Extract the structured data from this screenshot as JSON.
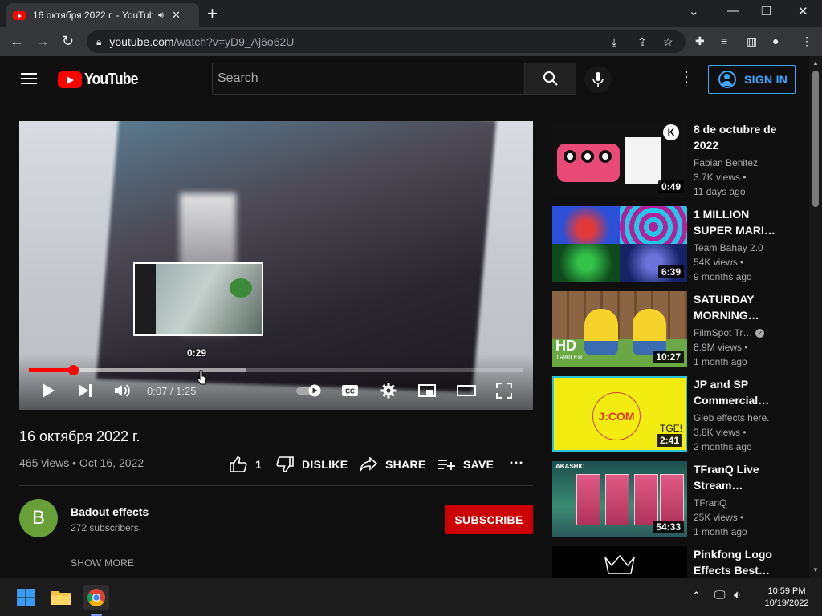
{
  "browser": {
    "tab_title": "16 октября 2022 г. - YouTube",
    "url_host": "youtube.com",
    "url_path": "/watch?v=yD9_Aj6o62U"
  },
  "header": {
    "logo_text": "YouTube",
    "search_placeholder": "Search",
    "signin_label": "SIGN IN"
  },
  "player": {
    "current_time": "0:07",
    "duration": "1:25",
    "time_display": "0:07 / 1:25",
    "hover_preview_time": "0:29",
    "progress_fraction": 0.09,
    "buffer_fraction": 0.44
  },
  "video": {
    "title": "16 октября 2022 г.",
    "meta": "465 views • Oct 16, 2022",
    "like_count": "1",
    "dislike_label": "DISLIKE",
    "share_label": "SHARE",
    "save_label": "SAVE"
  },
  "channel": {
    "initial": "B",
    "name": "Badout effects",
    "subscribers": "272 subscribers",
    "subscribe_label": "SUBSCRIBE",
    "show_more_label": "SHOW MORE",
    "avatar_color": "#689f38"
  },
  "recommendations": [
    {
      "title": "8 de octubre de 2022",
      "channel": "Fabian Benitez",
      "views": "3.7K views •",
      "age": "11 days ago",
      "duration": "0:49"
    },
    {
      "title": "1 MILLION SUPER MARI…",
      "channel": "Team Bahay 2.0",
      "views": "54K views •",
      "age": "9 months ago",
      "duration": "6:39"
    },
    {
      "title": "SATURDAY MORNING…",
      "channel": "FilmSpot Tr…",
      "views": "8.9M views •",
      "age": "1 month ago",
      "duration": "10:27",
      "verified": true
    },
    {
      "title": "JP and SP Commercial…",
      "channel": "Gleb effects here.",
      "views": "3.8K views •",
      "age": "2 months ago",
      "duration": "2:41"
    },
    {
      "title": "TFranQ Live Stream…",
      "channel": "TFranQ",
      "views": "25K views •",
      "age": "1 month ago",
      "duration": "54:33"
    },
    {
      "title": "Pinkfong Logo Effects Best…",
      "channel": "",
      "views": "",
      "age": "",
      "duration": ""
    }
  ],
  "thumb_text": {
    "t1_logo": "K",
    "t3_hd": "HD",
    "t3_trailer": "TRAILER",
    "t4_logo": "J:COM",
    "t4_tag": "TGE!",
    "t5_brand": "AKASHIC"
  },
  "taskbar": {
    "time": "10:59 PM",
    "date": "10/19/2022"
  },
  "colors": {
    "accent_red": "#ff0000",
    "subscribe_red": "#cc0000",
    "signin_blue": "#3ea6ff",
    "background": "#0f0f0f"
  }
}
